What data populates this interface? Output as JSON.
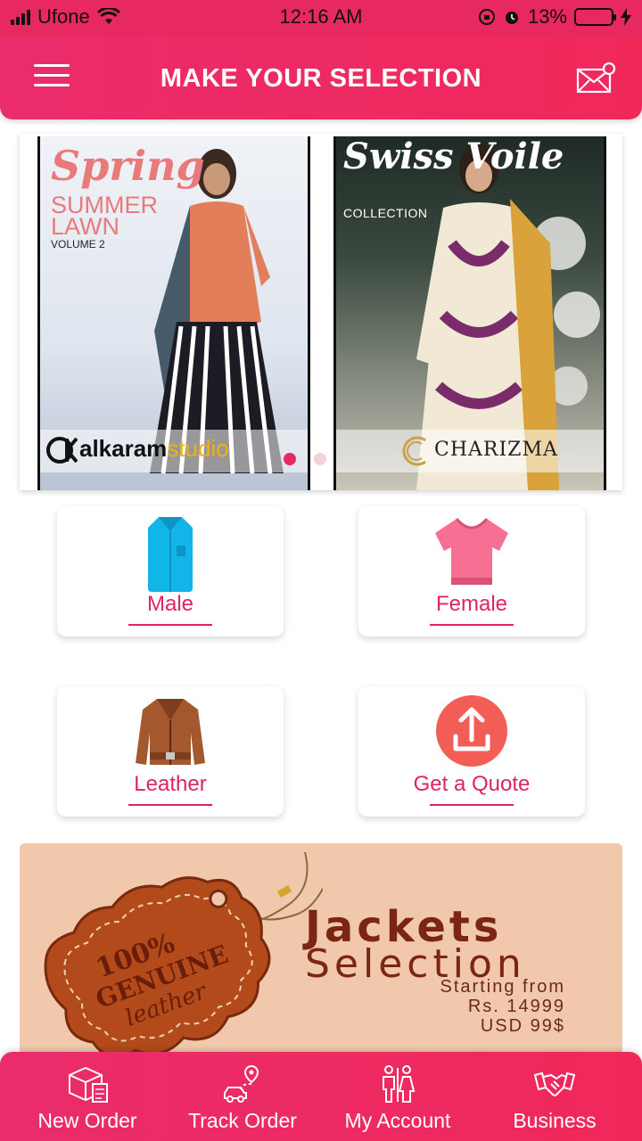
{
  "status_bar": {
    "carrier": "Ufone",
    "time": "12:16 AM",
    "battery": "13%",
    "battery_level": 0.13
  },
  "header": {
    "title": "MAKE YOUR SELECTION",
    "menu_icon": "hamburger-menu-icon",
    "mail_icon": "mail-notification-icon"
  },
  "banner": {
    "slides": [
      {
        "script": "Spring",
        "line1": "SUMMER",
        "line2": "LAWN",
        "line3": "VOLUME 2",
        "brand": "alkaram",
        "brand_suffix": "studio"
      },
      {
        "script": "Swiss Voile",
        "line1": "COLLECTION",
        "brand": "CHARIZMA"
      }
    ],
    "active_dot": 0,
    "dot_count": 2
  },
  "categories": [
    {
      "label": "Male",
      "icon": "shirt-icon"
    },
    {
      "label": "Female",
      "icon": "blouse-icon"
    },
    {
      "label": "Leather",
      "icon": "leather-jacket-icon"
    },
    {
      "label": "Get a Quote",
      "icon": "upload-icon"
    }
  ],
  "promo": {
    "tag_line1": "100%",
    "tag_line2": "GENUINE",
    "tag_line3": "leather",
    "title1": "Jackets",
    "title2": "Selection",
    "line1": "Starting from",
    "line2": "Rs. 14999",
    "line3": "USD 99$"
  },
  "bottom_nav": [
    {
      "label": "New Order",
      "icon": "package-icon"
    },
    {
      "label": "Track Order",
      "icon": "delivery-track-icon"
    },
    {
      "label": "My Account",
      "icon": "people-icon"
    },
    {
      "label": "Business",
      "icon": "handshake-icon"
    }
  ],
  "colors": {
    "primary": "#e8295f",
    "accent_text": "#e0245e",
    "promo_bg": "#f1c8ab"
  }
}
